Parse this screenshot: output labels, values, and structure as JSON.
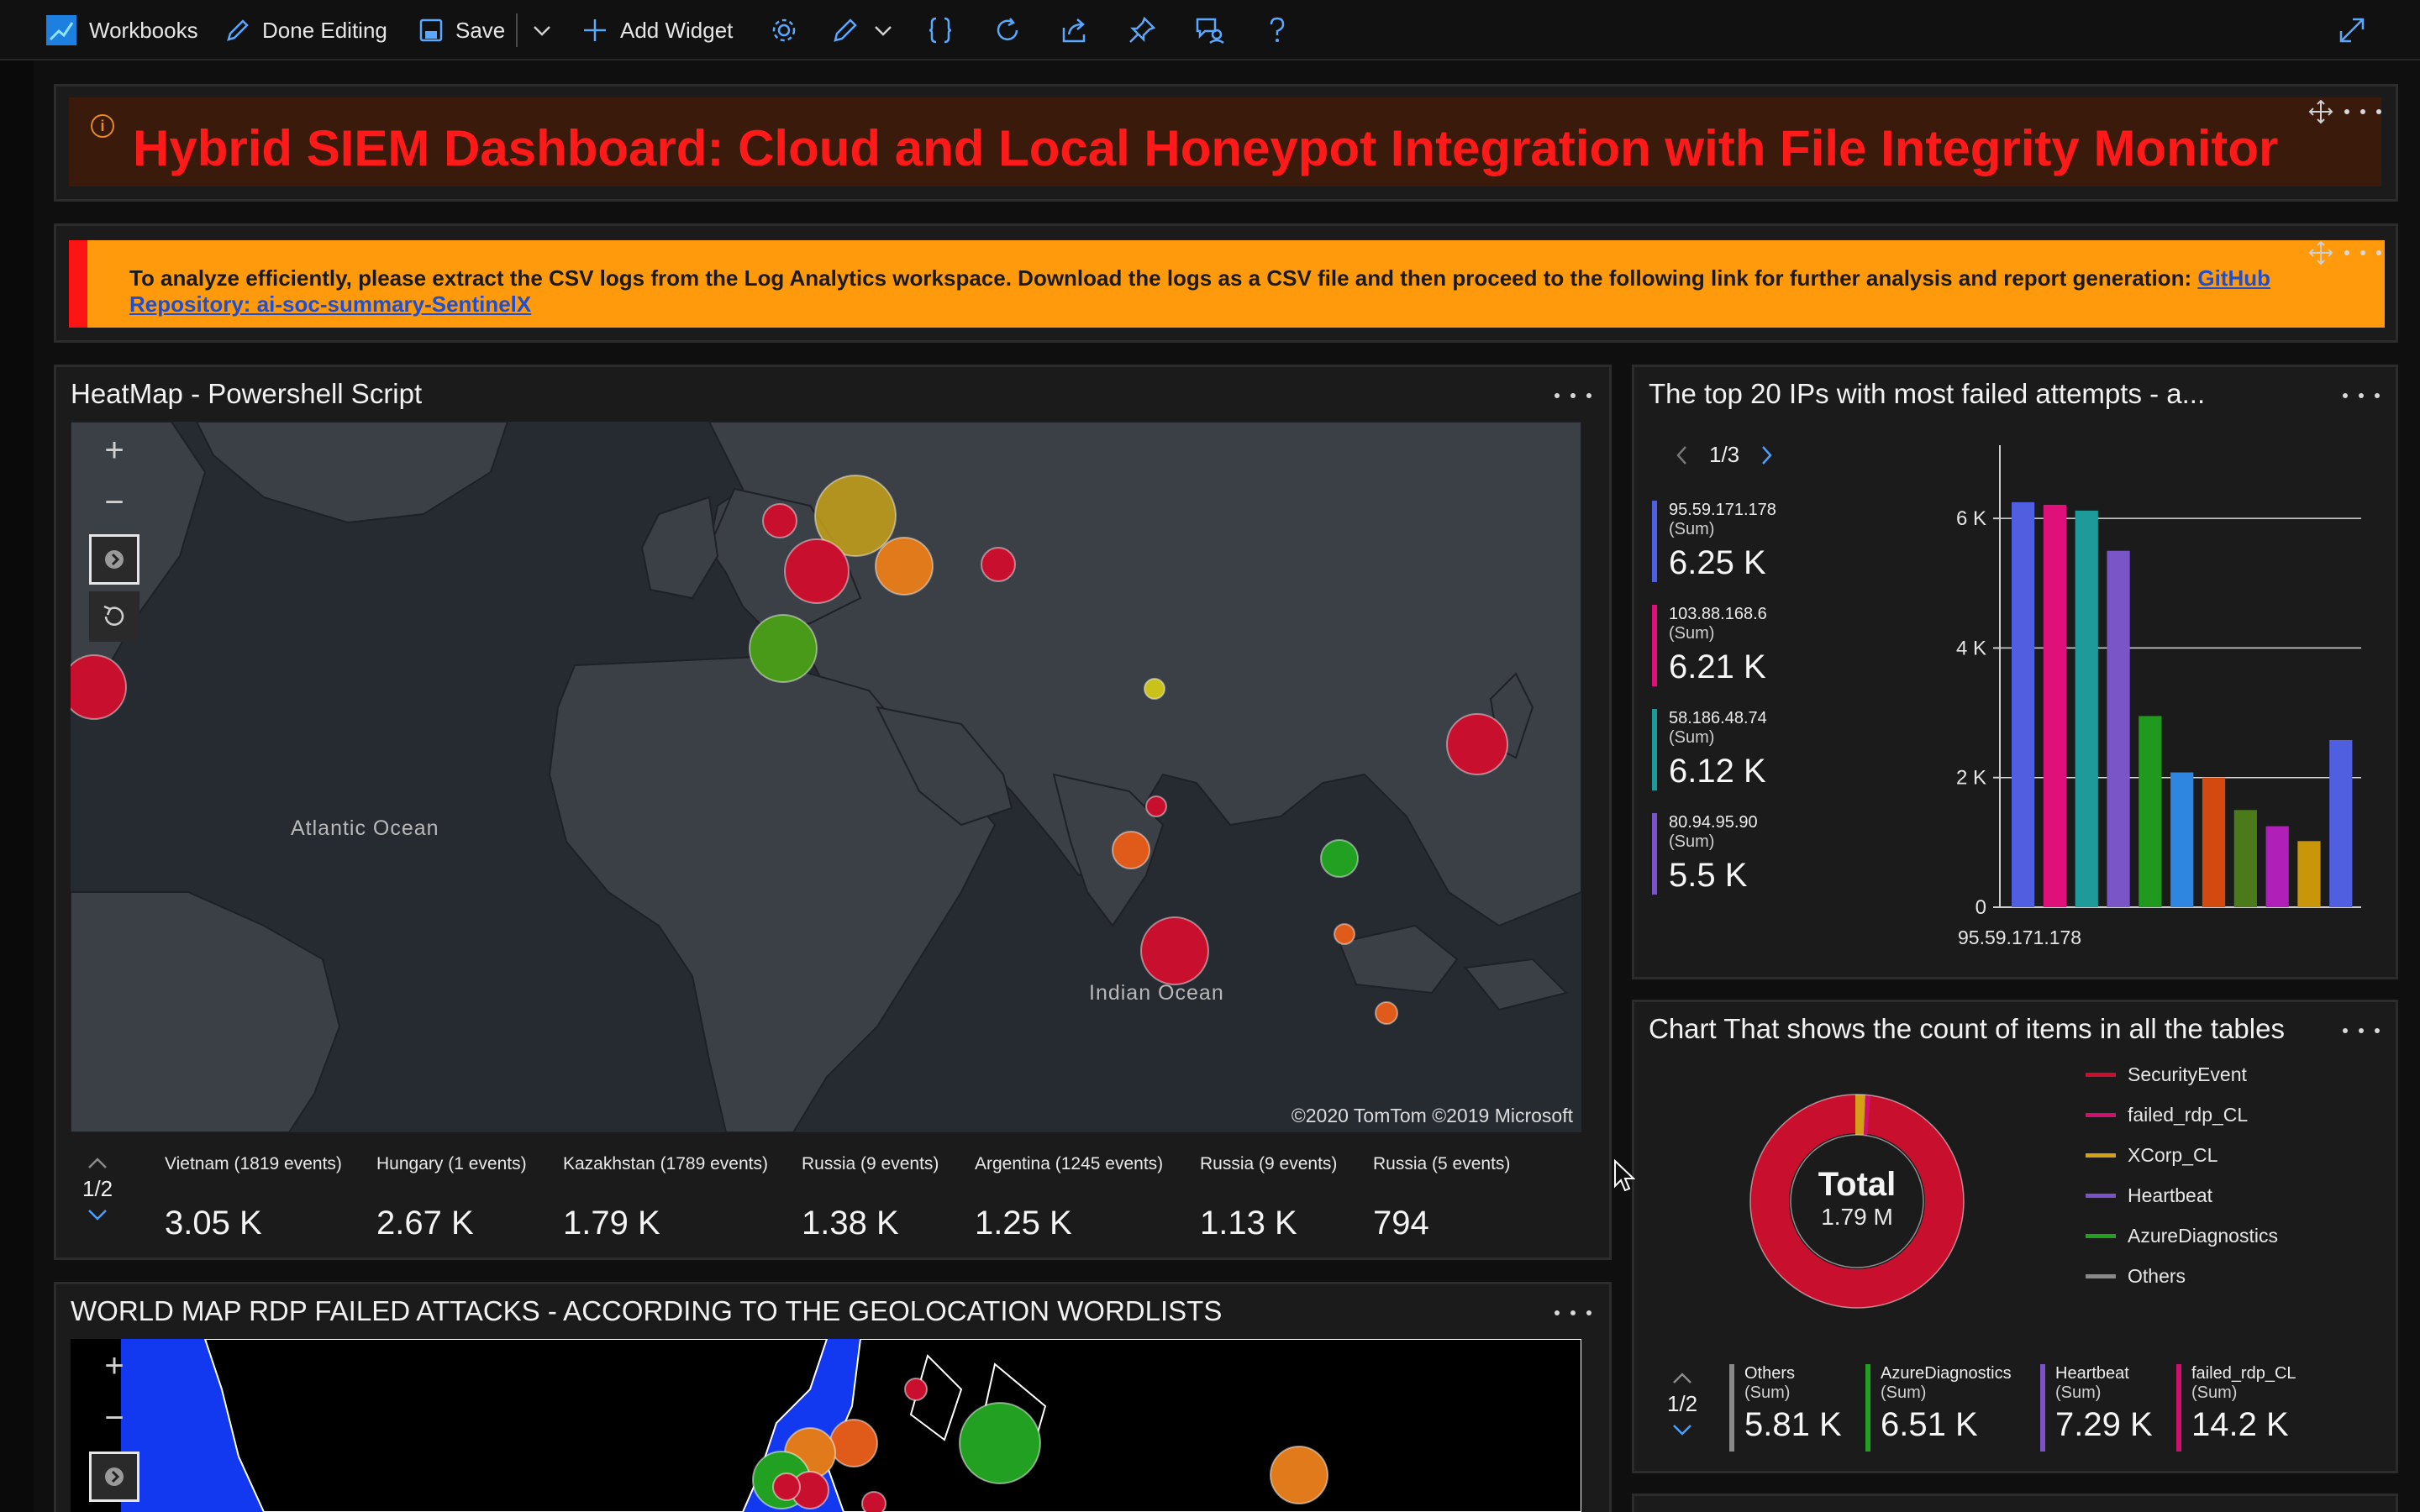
{
  "toolbar": {
    "workbooks": "Workbooks",
    "done_editing": "Done Editing",
    "save": "Save",
    "add_widget": "Add Widget"
  },
  "header": {
    "title": "Hybrid SIEM Dashboard: Cloud and Local Honeypot Integration with File Integrity Monitor",
    "info_glyph": "i"
  },
  "notice": {
    "text": "To analyze efficiently, please extract the CSV logs from the Log Analytics workspace. Download the logs as a CSV file and then proceed to the following link for further analysis and report generation: ",
    "link_text": "GitHub Repository: ai-soc-summary-SentinelX"
  },
  "heatmap": {
    "title": "HeatMap - Powershell Script",
    "ocean_atlantic": "Atlantic Ocean",
    "ocean_indian": "Indian Ocean",
    "copyright": "©2020 TomTom ©2019 Microsoft",
    "pager": "1/2",
    "tiles": [
      {
        "caption": "Vietnam (1819 events)",
        "value": "3.05 K"
      },
      {
        "caption": "Hungary (1 events)",
        "value": "2.67 K"
      },
      {
        "caption": "Kazakhstan (1789 events)",
        "value": "1.79 K"
      },
      {
        "caption": "Russia (9 events)",
        "value": "1.38 K"
      },
      {
        "caption": "Argentina (1245 events)",
        "value": "1.25 K"
      },
      {
        "caption": "Russia (9 events)",
        "value": "1.13 K"
      },
      {
        "caption": "Russia (5 events)",
        "value": "794"
      }
    ]
  },
  "worldmap": {
    "title": "WORLD MAP RDP FAILED ATTACKS - ACCORDING TO THE GEOLOCATION WORDLISTS"
  },
  "top_ips": {
    "title": "The top 20 IPs with most failed attempts - a...",
    "pager": "1/3",
    "x_label": "95.59.171.178",
    "legend": [
      {
        "name": "95.59.171.178",
        "sub": "(Sum)",
        "value": "6.25 K",
        "color": "#4f5fe0"
      },
      {
        "name": "103.88.168.6",
        "sub": "(Sum)",
        "value": "6.21 K",
        "color": "#e0107a"
      },
      {
        "name": "58.186.48.74",
        "sub": "(Sum)",
        "value": "6.12 K",
        "color": "#1f9a9a"
      },
      {
        "name": "80.94.95.90",
        "sub": "(Sum)",
        "value": "5.5 K",
        "color": "#7a55c8"
      }
    ]
  },
  "chart_data": {
    "type": "bar",
    "title": "The top 20 IPs with most failed attempts - a...",
    "yticks": [
      "0",
      "2 K",
      "4 K",
      "6 K"
    ],
    "ylim": [
      0,
      7000
    ],
    "grid": true,
    "series": [
      {
        "name": "95.59.171.178",
        "value": 6250,
        "color": "#4f5fe0"
      },
      {
        "name": "103.88.168.6",
        "value": 6210,
        "color": "#e0107a"
      },
      {
        "name": "58.186.48.74",
        "value": 6120,
        "color": "#1f9a9a"
      },
      {
        "name": "80.94.95.90",
        "value": 5500,
        "color": "#7a55c8"
      },
      {
        "value": 2950,
        "color": "#1f9a1f"
      },
      {
        "value": 2080,
        "color": "#2f86e0"
      },
      {
        "value": 2000,
        "color": "#d24a10"
      },
      {
        "value": 1500,
        "color": "#4a7a1a"
      },
      {
        "value": 1250,
        "color": "#b01fb8"
      },
      {
        "value": 1020,
        "color": "#c9960a"
      },
      {
        "value": 2580,
        "color": "#4f5fe0"
      }
    ]
  },
  "tables_chart": {
    "title": "Chart That shows the count of items in all the tables",
    "total_label": "Total",
    "total_value": "1.79 M",
    "pager": "1/2",
    "legend": [
      {
        "name": "SecurityEvent",
        "color": "#c8102e"
      },
      {
        "name": "failed_rdp_CL",
        "color": "#d0106e"
      },
      {
        "name": "XCorp_CL",
        "color": "#d4a017"
      },
      {
        "name": "Heartbeat",
        "color": "#7b52c8"
      },
      {
        "name": "AzureDiagnostics",
        "color": "#22a022"
      },
      {
        "name": "Others",
        "color": "#8a8a8a"
      }
    ],
    "tiles": [
      {
        "name": "Others",
        "sub": "(Sum)",
        "value": "5.81 K",
        "color": "#8a8a8a"
      },
      {
        "name": "AzureDiagnostics",
        "sub": "(Sum)",
        "value": "6.51 K",
        "color": "#22a022"
      },
      {
        "name": "Heartbeat",
        "sub": "(Sum)",
        "value": "7.29 K",
        "color": "#7b52c8"
      },
      {
        "name": "failed_rdp_CL",
        "sub": "(Sum)",
        "value": "14.2 K",
        "color": "#d0106e"
      }
    ]
  }
}
